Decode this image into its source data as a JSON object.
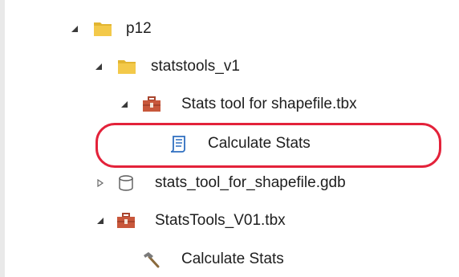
{
  "tree": {
    "items": [
      {
        "label": "p12",
        "expand_state": "expanded",
        "icon": "folder-icon"
      },
      {
        "label": "statstools_v1",
        "expand_state": "expanded",
        "icon": "folder-icon"
      },
      {
        "label": "Stats tool for shapefile.tbx",
        "expand_state": "expanded",
        "icon": "toolbox-icon"
      },
      {
        "label": "Calculate Stats",
        "expand_state": "none",
        "icon": "script-tool-icon"
      },
      {
        "label": "stats_tool_for_shapefile.gdb",
        "expand_state": "collapsed",
        "icon": "geodatabase-icon"
      },
      {
        "label": "StatsTools_V01.tbx",
        "expand_state": "expanded",
        "icon": "toolbox-icon"
      },
      {
        "label": "Calculate Stats",
        "expand_state": "none",
        "icon": "hammer-tool-icon"
      }
    ]
  },
  "colors": {
    "highlight_ring": "#e3223a",
    "folder": "#f3c94a",
    "toolbox": "#c8573b",
    "script_tool": "#2f6fc0",
    "text": "#1e1e1e"
  }
}
